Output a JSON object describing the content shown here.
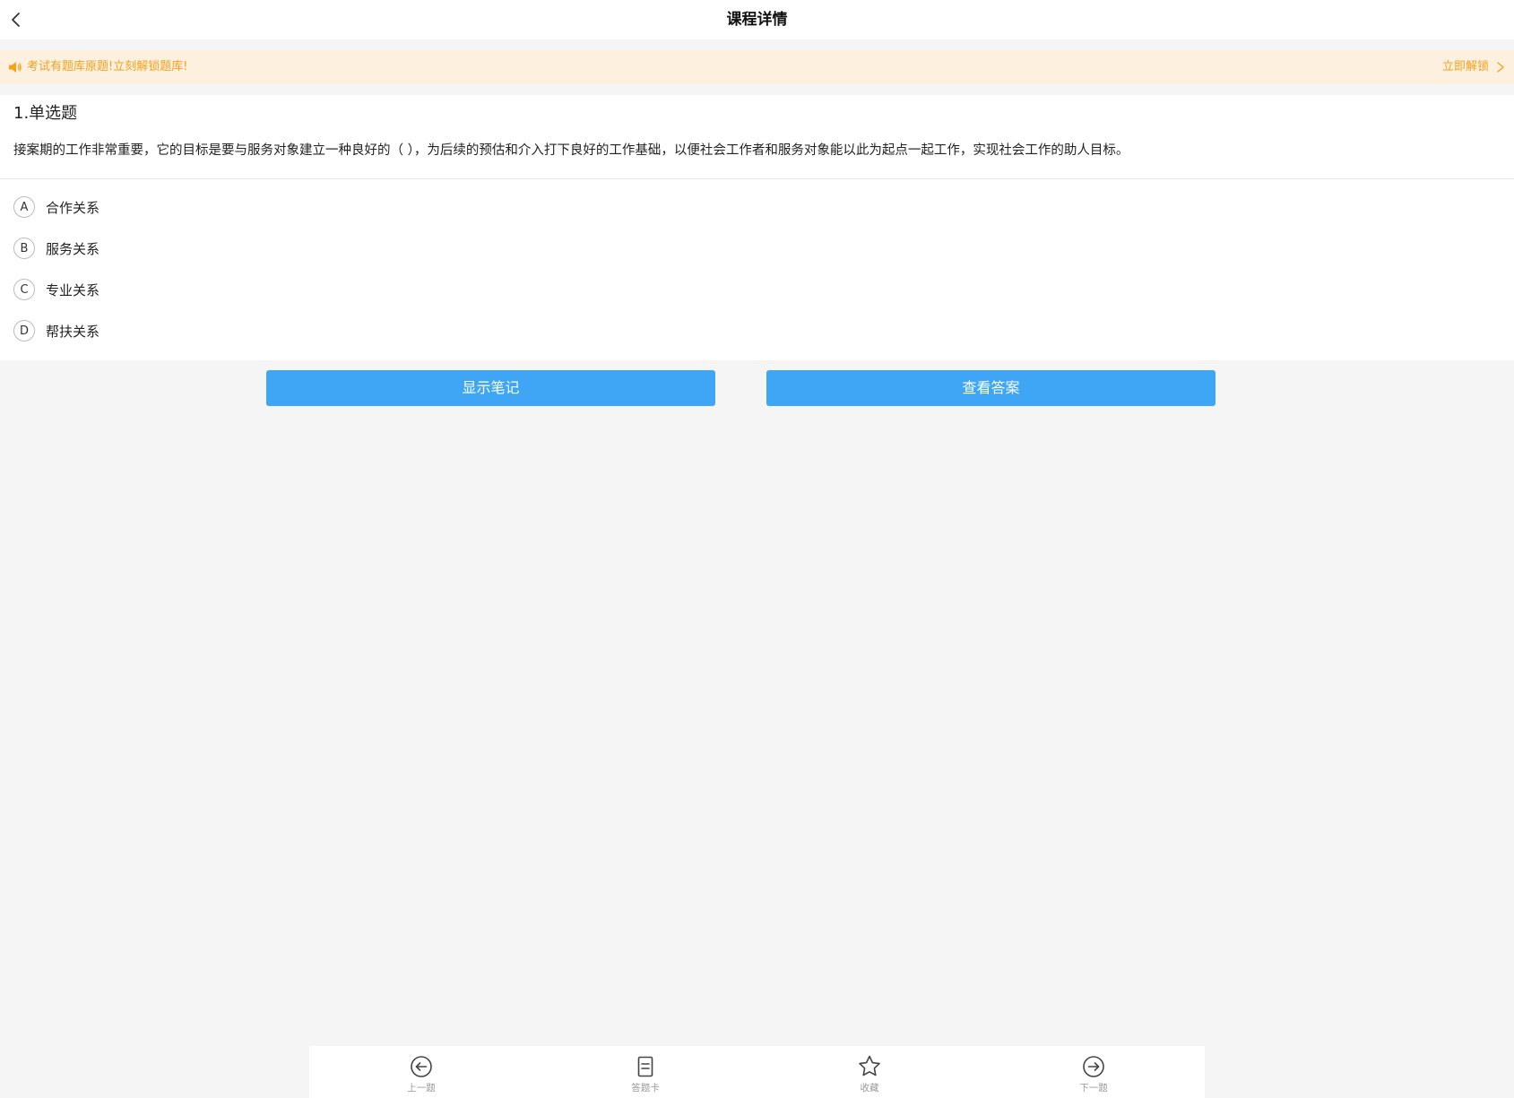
{
  "header": {
    "title": "课程详情",
    "back_icon": "chevron-left-icon"
  },
  "notice": {
    "icon": "speaker-icon",
    "text": "考试有题库原题!立刻解锁题库!",
    "action_label": "立即解锁",
    "color": "#f5a11c",
    "background": "#fdf0df"
  },
  "question": {
    "type_label": "1.单选题",
    "stem": "接案期的工作非常重要，它的目标是要与服务对象建立一种良好的（ ），为后续的预估和介入打下良好的工作基础，以便社会工作者和服务对象能以此为起点一起工作，实现社会工作的助人目标。",
    "options": [
      {
        "letter": "A",
        "text": "合作关系"
      },
      {
        "letter": "B",
        "text": "服务关系"
      },
      {
        "letter": "C",
        "text": "专业关系"
      },
      {
        "letter": "D",
        "text": "帮扶关系"
      }
    ]
  },
  "actions": {
    "show_notes": "显示笔记",
    "view_answer": "查看答案",
    "button_color": "#3fa6f5"
  },
  "tabbar": {
    "items": [
      {
        "label": "上一题",
        "icon": "arrow-left-circle-icon"
      },
      {
        "label": "答题卡",
        "icon": "answer-card-icon"
      },
      {
        "label": "收藏",
        "icon": "star-icon"
      },
      {
        "label": "下一题",
        "icon": "arrow-right-circle-icon"
      }
    ]
  }
}
